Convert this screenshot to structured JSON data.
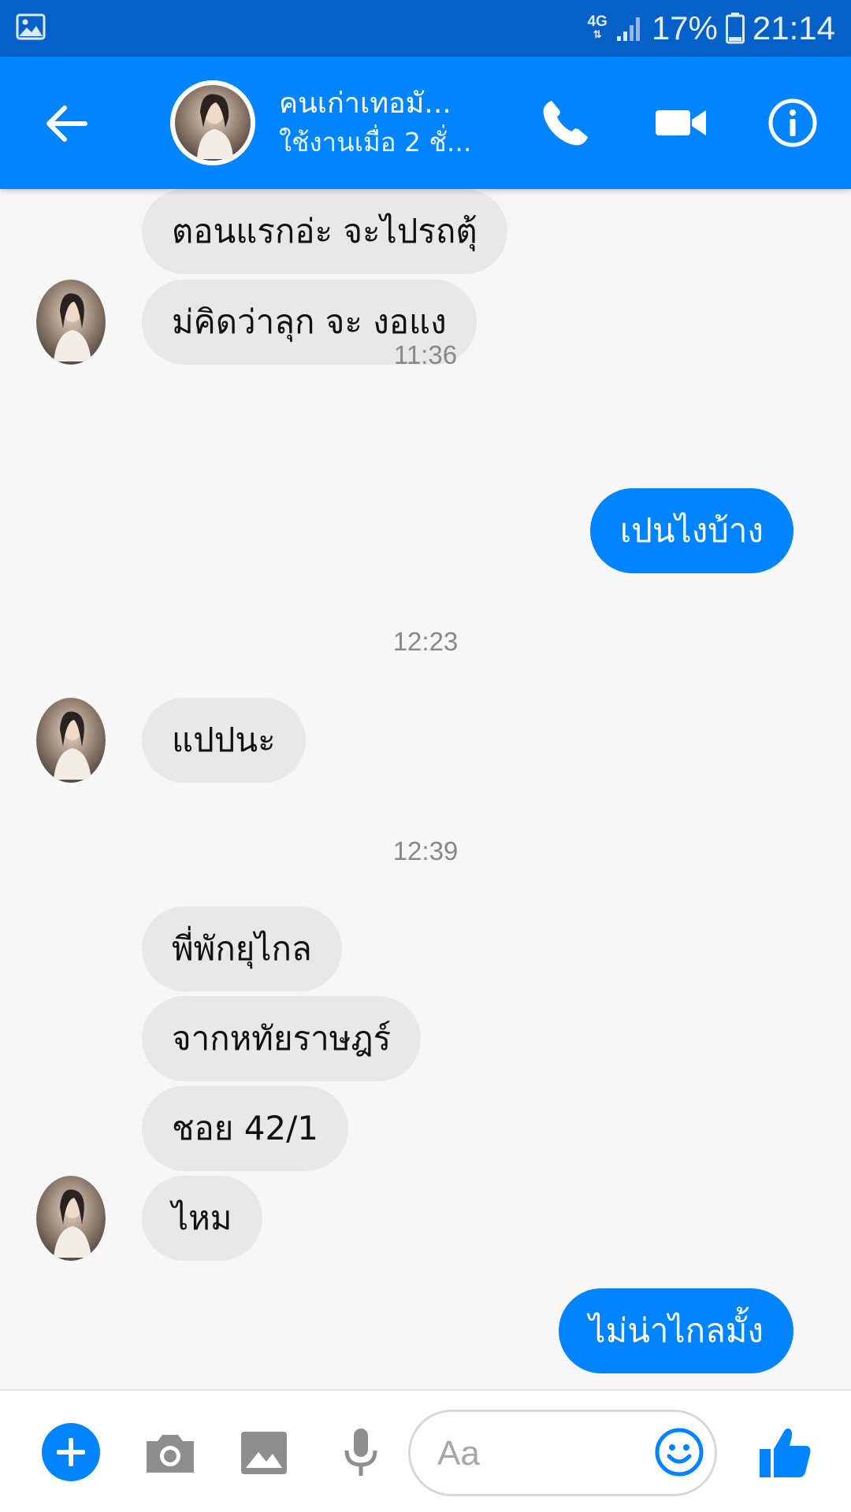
{
  "status_bar": {
    "network": "4G",
    "battery_percent": "17%",
    "time": "21:14"
  },
  "header": {
    "contact_name": "คนเก่าเทอมั...",
    "active_status": "ใช้งานเมื่อ 2 ชั่..."
  },
  "messages": {
    "m1": "ตอนแรกอ่ะ จะไปรถตุ้",
    "m2": "ม่คิดว่าลุก จะ งอแง",
    "t1": "11:36",
    "m3": "เปนไงบ้าง",
    "t2": "12:23",
    "m4": "แปปนะ",
    "t3": "12:39",
    "m5": "พี่พักยุไกล",
    "m6": "จากหทัยราษฎร์",
    "m7": "ชอย 42/1",
    "m8": "ไหม",
    "m9": "ไม่น่าไกลมั้ง"
  },
  "composer": {
    "placeholder": "Aa"
  },
  "colors": {
    "accent": "#0084ff",
    "status_bar": "#0560c8",
    "incoming_bubble": "#e8e8e8",
    "background": "#f7f7f7"
  },
  "icons": {
    "status_left": "gallery-icon",
    "header": [
      "back-arrow-icon",
      "phone-icon",
      "video-camera-icon",
      "info-icon"
    ],
    "composer": [
      "plus-icon",
      "camera-icon",
      "image-icon",
      "microphone-icon",
      "emoji-icon",
      "thumbs-up-icon"
    ]
  }
}
